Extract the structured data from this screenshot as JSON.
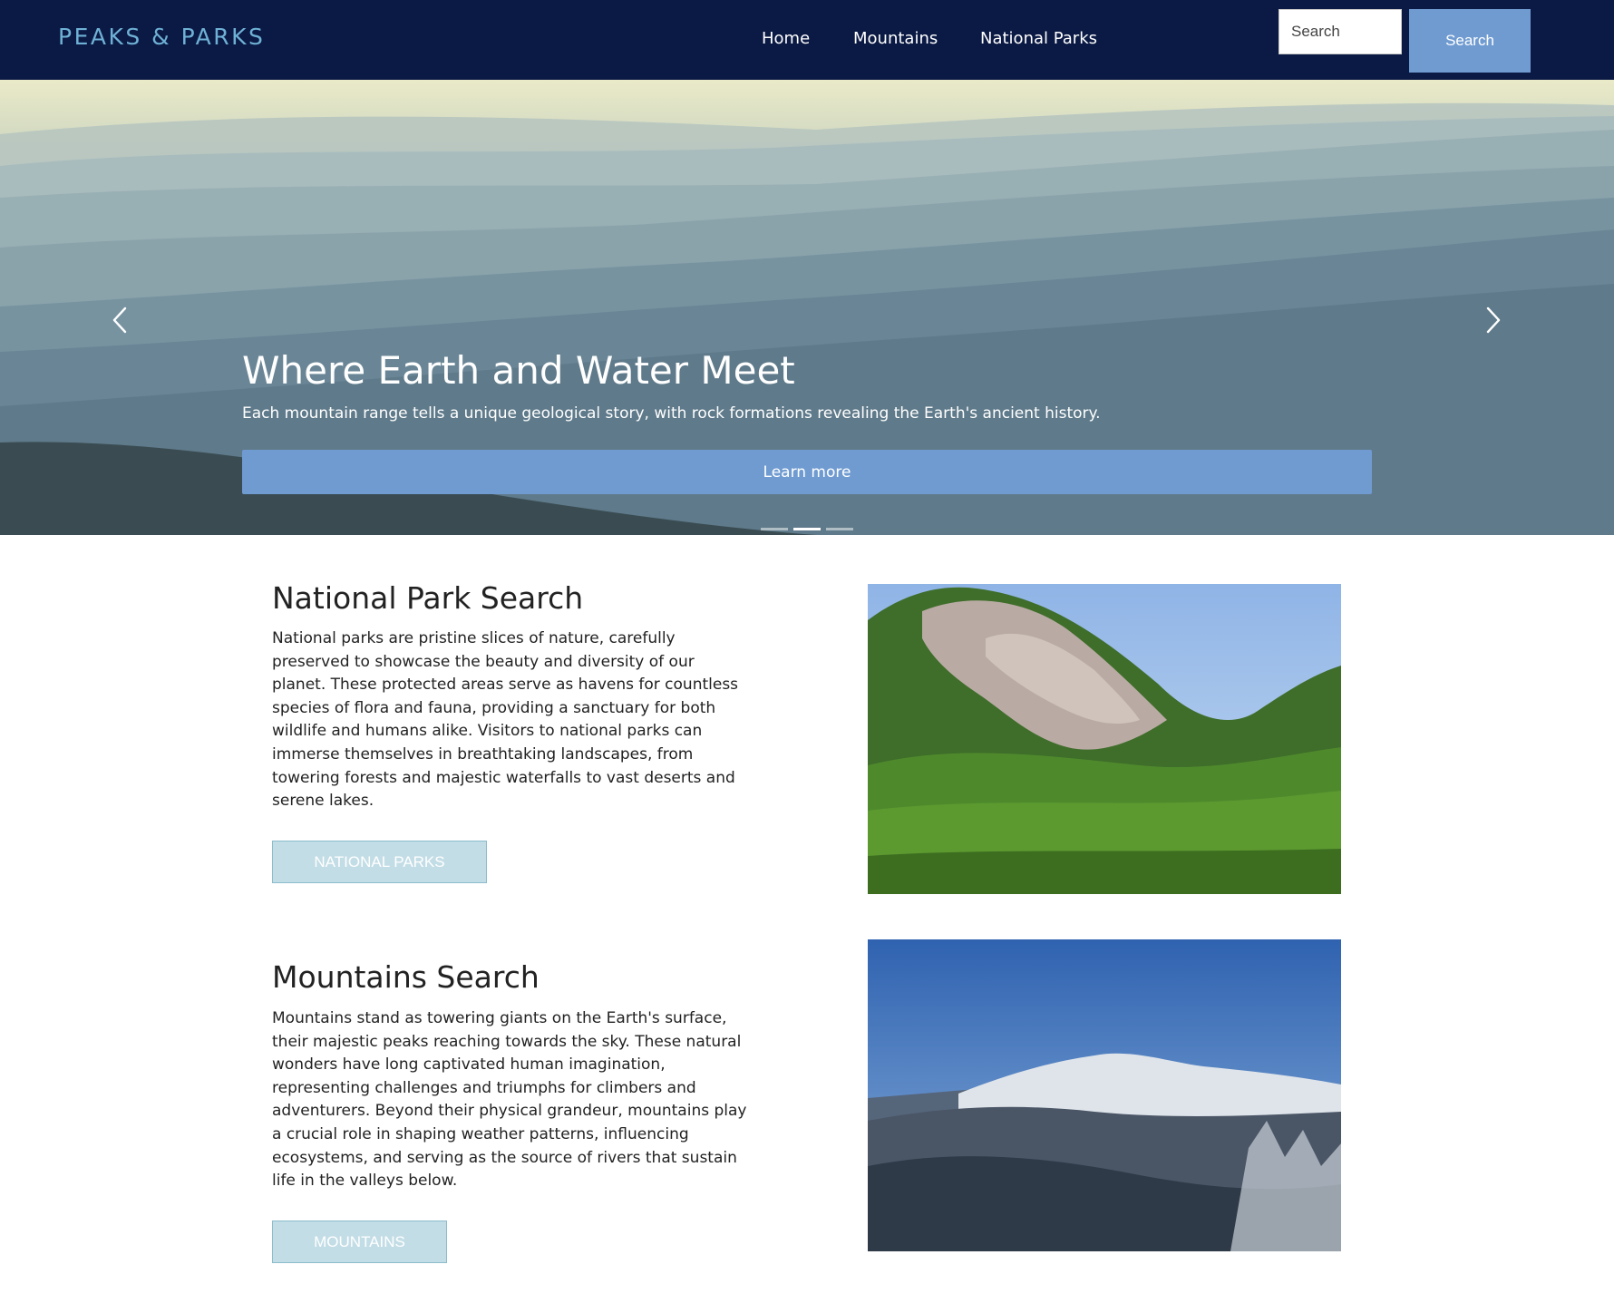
{
  "brand": {
    "name": "PEAKS & PARKS"
  },
  "nav": {
    "items": [
      {
        "label": "Home"
      },
      {
        "label": "Mountains"
      },
      {
        "label": "National Parks"
      }
    ],
    "search": {
      "placeholder": "Search",
      "button_label": "Search"
    }
  },
  "hero": {
    "title": "Where Earth and Water Meet",
    "subtitle": "Each mountain range tells a unique geological story, with rock formations revealing the Earth's ancient history.",
    "cta_label": "Learn more",
    "slide_count": 3,
    "active_slide": 2,
    "prev_icon": "chevron-left-icon",
    "next_icon": "chevron-right-icon"
  },
  "sections": [
    {
      "title": "National Park Search",
      "text": "National parks are pristine slices of nature, carefully preserved to showcase the beauty and diversity of our planet. These protected areas serve as havens for countless species of flora and fauna, providing a sanctuary for both wildlife and humans alike. Visitors to national parks can immerse themselves in breathtaking landscapes, from towering forests and majestic waterfalls to vast deserts and serene lakes.",
      "button_label": "NATIONAL PARKS"
    },
    {
      "title": "Mountains Search",
      "text": "Mountains stand as towering giants on the Earth's surface, their majestic peaks reaching towards the sky. These natural wonders have long captivated human imagination, representing challenges and triumphs for climbers and adventurers. Beyond their physical grandeur, mountains play a crucial role in shaping weather patterns, influencing ecosystems, and serving as the source of rivers that sustain life in the valleys below.",
      "button_label": "MOUNTAINS"
    }
  ],
  "colors": {
    "navbar_bg": "#0b1a44",
    "brand": "#6fb1d6",
    "accent_button": "#6f9bd1",
    "section_button_bg": "#c3dde6"
  }
}
